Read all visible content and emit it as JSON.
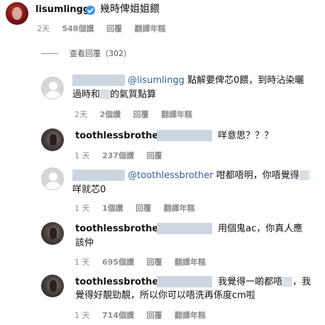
{
  "post": {
    "username": "lisumlingg",
    "text": "幾時俾姐姐餵",
    "time": "2天",
    "likes": "548個讚",
    "reply": "回覆",
    "translate": "翻譯年糕"
  },
  "view_replies": "查看回覆（302）",
  "replies": [
    {
      "mention": "@lisumlingg",
      "line1": " 點解要俾芯0餵，到時沾染曬",
      "line2a": "過時和",
      "line2b": "的氣質點算",
      "time": "2天",
      "likes": "2個讚",
      "reply": "回覆",
      "translate": "翻譯年糕"
    },
    {
      "username": "toothlessbrother",
      "line1": "咩意思？？？",
      "time": "1 天",
      "likes": "237個讚",
      "reply": "回覆"
    },
    {
      "mention": "@toothlessbrother",
      "line1": " 咁都唔明，你唔覺得",
      "line2": "咩就芯0",
      "time": "1 天",
      "likes": "1個讚",
      "reply": "回覆",
      "translate": "翻譯年糕"
    },
    {
      "username": "toothlessbrother",
      "line1": "用個鬼ac，你真人應",
      "line2": "該仲",
      "time": "1 天",
      "likes": "695個讚",
      "reply": "回覆",
      "translate": "翻譯年糕"
    },
    {
      "username": "toothlessbrother",
      "line1a": "我覺得一啲都唔",
      "line1b": "，我",
      "line2": "覺得好靚勁靚，所以你可以唔洗再係度cm啦",
      "time": "1 天",
      "likes": "714個讚",
      "reply": "回覆",
      "translate": "翻譯年糕"
    }
  ]
}
